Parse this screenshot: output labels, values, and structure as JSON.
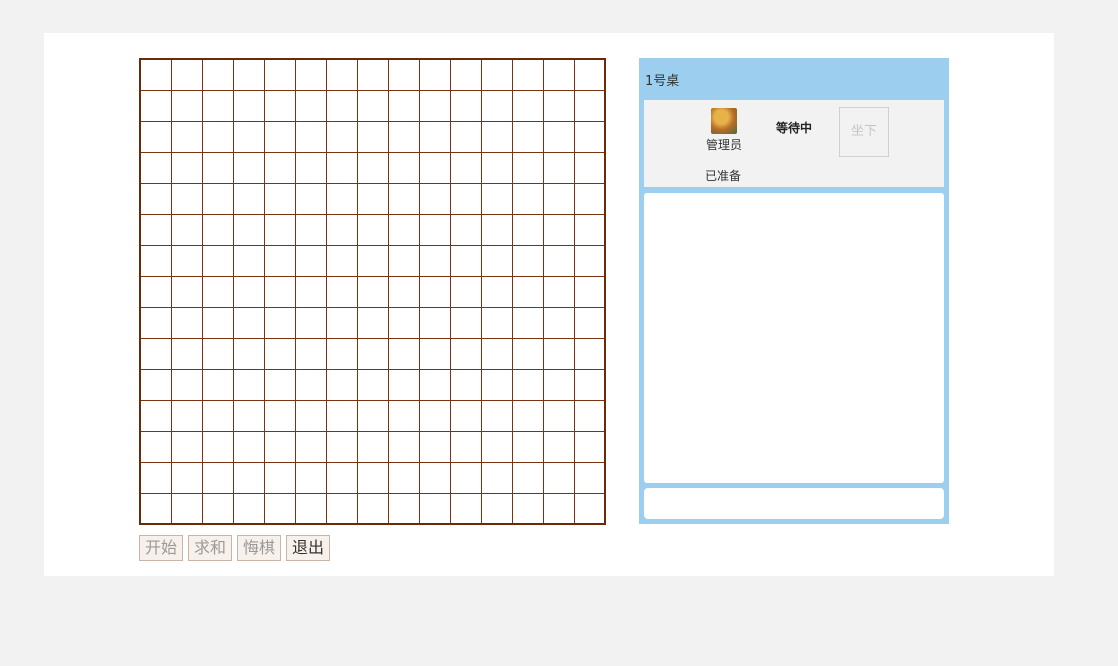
{
  "controls": {
    "start": "开始",
    "draw": "求和",
    "undo": "悔棋",
    "exit": "退出"
  },
  "table": {
    "title": "1号桌",
    "player": {
      "name": "管理员",
      "ready_status": "已准备"
    },
    "opponent_status": "等待中",
    "sit_label": "坐下",
    "chat_input": {
      "value": "",
      "placeholder": ""
    }
  },
  "board": {
    "rows": 15,
    "cols": 15,
    "line_color": "#7a3210"
  },
  "colors": {
    "panel_accent": "#9ccef0",
    "page_background": "#f2f2f2"
  }
}
